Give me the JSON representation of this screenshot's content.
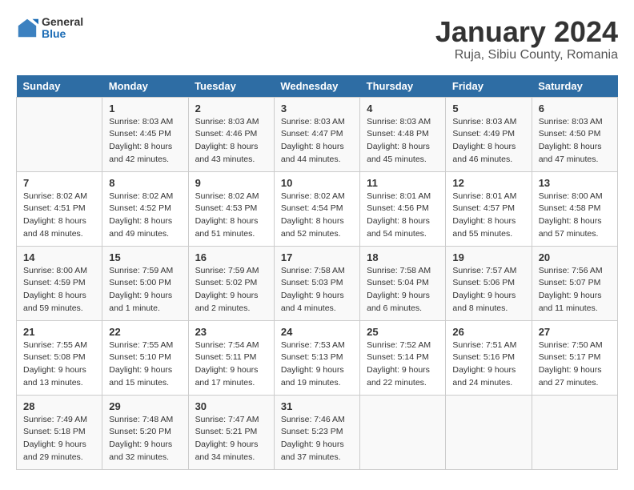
{
  "logo": {
    "general": "General",
    "blue": "Blue"
  },
  "title": "January 2024",
  "subtitle": "Ruja, Sibiu County, Romania",
  "weekdays": [
    "Sunday",
    "Monday",
    "Tuesday",
    "Wednesday",
    "Thursday",
    "Friday",
    "Saturday"
  ],
  "weeks": [
    [
      {
        "day": "",
        "sunrise": "",
        "sunset": "",
        "daylight": ""
      },
      {
        "day": "1",
        "sunrise": "Sunrise: 8:03 AM",
        "sunset": "Sunset: 4:45 PM",
        "daylight": "Daylight: 8 hours and 42 minutes."
      },
      {
        "day": "2",
        "sunrise": "Sunrise: 8:03 AM",
        "sunset": "Sunset: 4:46 PM",
        "daylight": "Daylight: 8 hours and 43 minutes."
      },
      {
        "day": "3",
        "sunrise": "Sunrise: 8:03 AM",
        "sunset": "Sunset: 4:47 PM",
        "daylight": "Daylight: 8 hours and 44 minutes."
      },
      {
        "day": "4",
        "sunrise": "Sunrise: 8:03 AM",
        "sunset": "Sunset: 4:48 PM",
        "daylight": "Daylight: 8 hours and 45 minutes."
      },
      {
        "day": "5",
        "sunrise": "Sunrise: 8:03 AM",
        "sunset": "Sunset: 4:49 PM",
        "daylight": "Daylight: 8 hours and 46 minutes."
      },
      {
        "day": "6",
        "sunrise": "Sunrise: 8:03 AM",
        "sunset": "Sunset: 4:50 PM",
        "daylight": "Daylight: 8 hours and 47 minutes."
      }
    ],
    [
      {
        "day": "7",
        "sunrise": "Sunrise: 8:02 AM",
        "sunset": "Sunset: 4:51 PM",
        "daylight": "Daylight: 8 hours and 48 minutes."
      },
      {
        "day": "8",
        "sunrise": "Sunrise: 8:02 AM",
        "sunset": "Sunset: 4:52 PM",
        "daylight": "Daylight: 8 hours and 49 minutes."
      },
      {
        "day": "9",
        "sunrise": "Sunrise: 8:02 AM",
        "sunset": "Sunset: 4:53 PM",
        "daylight": "Daylight: 8 hours and 51 minutes."
      },
      {
        "day": "10",
        "sunrise": "Sunrise: 8:02 AM",
        "sunset": "Sunset: 4:54 PM",
        "daylight": "Daylight: 8 hours and 52 minutes."
      },
      {
        "day": "11",
        "sunrise": "Sunrise: 8:01 AM",
        "sunset": "Sunset: 4:56 PM",
        "daylight": "Daylight: 8 hours and 54 minutes."
      },
      {
        "day": "12",
        "sunrise": "Sunrise: 8:01 AM",
        "sunset": "Sunset: 4:57 PM",
        "daylight": "Daylight: 8 hours and 55 minutes."
      },
      {
        "day": "13",
        "sunrise": "Sunrise: 8:00 AM",
        "sunset": "Sunset: 4:58 PM",
        "daylight": "Daylight: 8 hours and 57 minutes."
      }
    ],
    [
      {
        "day": "14",
        "sunrise": "Sunrise: 8:00 AM",
        "sunset": "Sunset: 4:59 PM",
        "daylight": "Daylight: 8 hours and 59 minutes."
      },
      {
        "day": "15",
        "sunrise": "Sunrise: 7:59 AM",
        "sunset": "Sunset: 5:00 PM",
        "daylight": "Daylight: 9 hours and 1 minute."
      },
      {
        "day": "16",
        "sunrise": "Sunrise: 7:59 AM",
        "sunset": "Sunset: 5:02 PM",
        "daylight": "Daylight: 9 hours and 2 minutes."
      },
      {
        "day": "17",
        "sunrise": "Sunrise: 7:58 AM",
        "sunset": "Sunset: 5:03 PM",
        "daylight": "Daylight: 9 hours and 4 minutes."
      },
      {
        "day": "18",
        "sunrise": "Sunrise: 7:58 AM",
        "sunset": "Sunset: 5:04 PM",
        "daylight": "Daylight: 9 hours and 6 minutes."
      },
      {
        "day": "19",
        "sunrise": "Sunrise: 7:57 AM",
        "sunset": "Sunset: 5:06 PM",
        "daylight": "Daylight: 9 hours and 8 minutes."
      },
      {
        "day": "20",
        "sunrise": "Sunrise: 7:56 AM",
        "sunset": "Sunset: 5:07 PM",
        "daylight": "Daylight: 9 hours and 11 minutes."
      }
    ],
    [
      {
        "day": "21",
        "sunrise": "Sunrise: 7:55 AM",
        "sunset": "Sunset: 5:08 PM",
        "daylight": "Daylight: 9 hours and 13 minutes."
      },
      {
        "day": "22",
        "sunrise": "Sunrise: 7:55 AM",
        "sunset": "Sunset: 5:10 PM",
        "daylight": "Daylight: 9 hours and 15 minutes."
      },
      {
        "day": "23",
        "sunrise": "Sunrise: 7:54 AM",
        "sunset": "Sunset: 5:11 PM",
        "daylight": "Daylight: 9 hours and 17 minutes."
      },
      {
        "day": "24",
        "sunrise": "Sunrise: 7:53 AM",
        "sunset": "Sunset: 5:13 PM",
        "daylight": "Daylight: 9 hours and 19 minutes."
      },
      {
        "day": "25",
        "sunrise": "Sunrise: 7:52 AM",
        "sunset": "Sunset: 5:14 PM",
        "daylight": "Daylight: 9 hours and 22 minutes."
      },
      {
        "day": "26",
        "sunrise": "Sunrise: 7:51 AM",
        "sunset": "Sunset: 5:16 PM",
        "daylight": "Daylight: 9 hours and 24 minutes."
      },
      {
        "day": "27",
        "sunrise": "Sunrise: 7:50 AM",
        "sunset": "Sunset: 5:17 PM",
        "daylight": "Daylight: 9 hours and 27 minutes."
      }
    ],
    [
      {
        "day": "28",
        "sunrise": "Sunrise: 7:49 AM",
        "sunset": "Sunset: 5:18 PM",
        "daylight": "Daylight: 9 hours and 29 minutes."
      },
      {
        "day": "29",
        "sunrise": "Sunrise: 7:48 AM",
        "sunset": "Sunset: 5:20 PM",
        "daylight": "Daylight: 9 hours and 32 minutes."
      },
      {
        "day": "30",
        "sunrise": "Sunrise: 7:47 AM",
        "sunset": "Sunset: 5:21 PM",
        "daylight": "Daylight: 9 hours and 34 minutes."
      },
      {
        "day": "31",
        "sunrise": "Sunrise: 7:46 AM",
        "sunset": "Sunset: 5:23 PM",
        "daylight": "Daylight: 9 hours and 37 minutes."
      },
      {
        "day": "",
        "sunrise": "",
        "sunset": "",
        "daylight": ""
      },
      {
        "day": "",
        "sunrise": "",
        "sunset": "",
        "daylight": ""
      },
      {
        "day": "",
        "sunrise": "",
        "sunset": "",
        "daylight": ""
      }
    ]
  ]
}
